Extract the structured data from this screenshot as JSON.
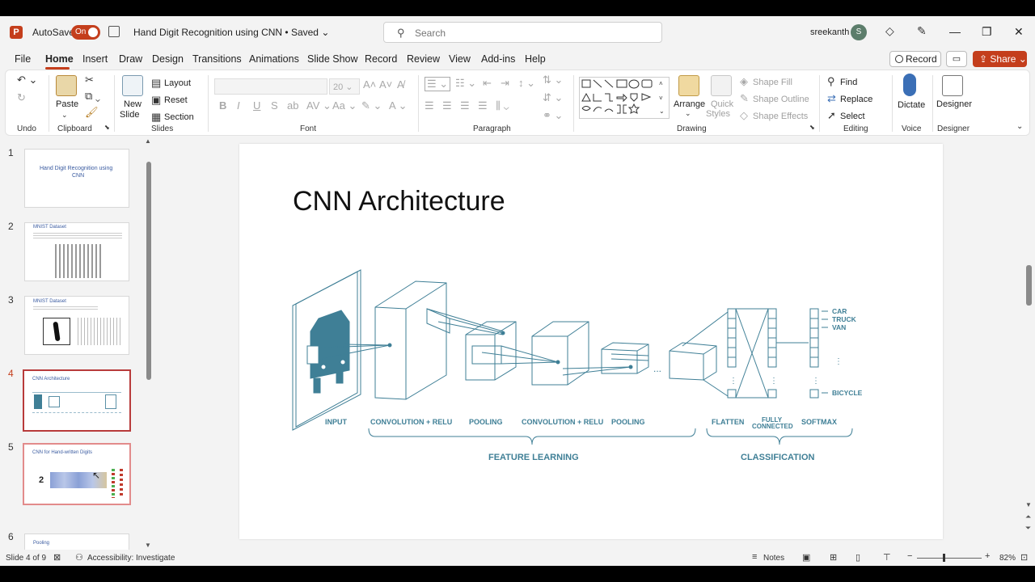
{
  "titlebar": {
    "autosave_label": "AutoSave",
    "autosave_state": "On",
    "doc_title": "Hand Digit Recognition using CNN • Saved",
    "search_placeholder": "Search",
    "user_name": "sreekanth",
    "avatar_initial": "S"
  },
  "menu": {
    "tabs": [
      "File",
      "Home",
      "Insert",
      "Draw",
      "Design",
      "Transitions",
      "Animations",
      "Slide Show",
      "Record",
      "Review",
      "View",
      "Add-ins",
      "Help"
    ],
    "active_tab": "Home",
    "record_label": "Record",
    "share_label": "Share"
  },
  "ribbon": {
    "groups": [
      "Undo",
      "Clipboard",
      "Slides",
      "Font",
      "Paragraph",
      "Drawing",
      "Editing",
      "Voice",
      "Designer"
    ],
    "paste": "Paste",
    "new_slide": "New",
    "new_slide2": "Slide",
    "layout": "Layout",
    "reset": "Reset",
    "section": "Section",
    "font_size": "20",
    "arrange": "Arrange",
    "quick_styles": "Quick",
    "quick_styles2": "Styles",
    "shape_fill": "Shape Fill",
    "shape_outline": "Shape Outline",
    "shape_effects": "Shape Effects",
    "find": "Find",
    "replace": "Replace",
    "select": "Select",
    "dictate": "Dictate",
    "designer": "Designer"
  },
  "thumbnails": [
    {
      "num": "1",
      "title": "Hand Digit Recognition using",
      "title2": "CNN"
    },
    {
      "num": "2",
      "title": "MNIST Dataset"
    },
    {
      "num": "3",
      "title": "MNIST Dataset"
    },
    {
      "num": "4",
      "title": "CNN Architecture"
    },
    {
      "num": "5",
      "title": "CNN for Hand-written Digits"
    },
    {
      "num": "6",
      "title": "Pooling"
    }
  ],
  "slide": {
    "title": "CNN Architecture",
    "diagram": {
      "stages": [
        "INPUT",
        "CONVOLUTION + RELU",
        "POOLING",
        "CONVOLUTION + RELU",
        "POOLING",
        "FLATTEN",
        "FULLY",
        "CONNECTED",
        "SOFTMAX"
      ],
      "outputs": [
        "CAR",
        "TRUCK",
        "VAN",
        "BICYCLE"
      ],
      "group_feature": "FEATURE LEARNING",
      "group_class": "CLASSIFICATION",
      "accent_color": "#3f7f96"
    }
  },
  "statusbar": {
    "slide_info": "Slide 4 of 9",
    "accessibility": "Accessibility: Investigate",
    "notes": "Notes",
    "zoom": "82%"
  }
}
